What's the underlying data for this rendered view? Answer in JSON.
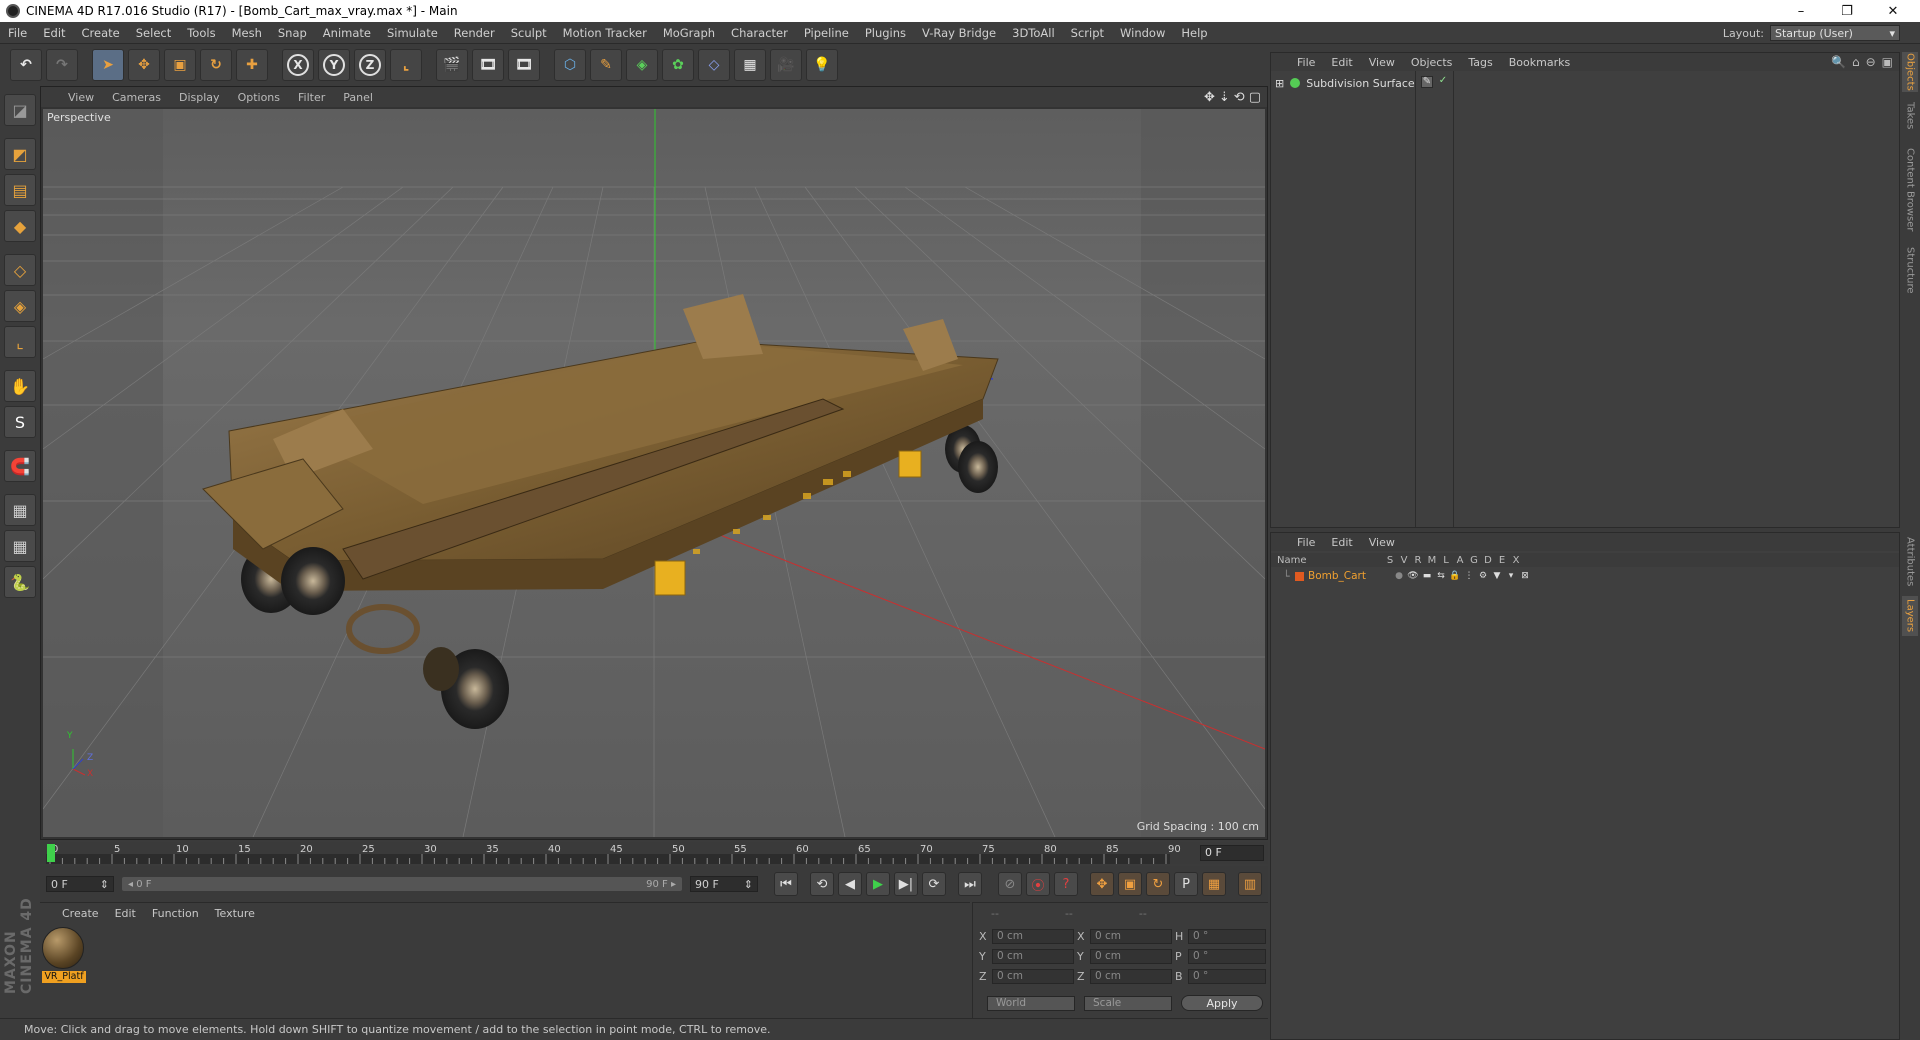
{
  "window": {
    "title": "CINEMA 4D R17.016 Studio (R17) - [Bomb_Cart_max_vray.max *] - Main",
    "controls": [
      "–",
      "❐",
      "✕"
    ]
  },
  "menu": [
    "File",
    "Edit",
    "Create",
    "Select",
    "Tools",
    "Mesh",
    "Snap",
    "Animate",
    "Simulate",
    "Render",
    "Sculpt",
    "Motion Tracker",
    "MoGraph",
    "Character",
    "Pipeline",
    "Plugins",
    "V-Ray Bridge",
    "3DToAll",
    "Script",
    "Window",
    "Help"
  ],
  "layout": {
    "label": "Layout:",
    "value": "Startup (User)"
  },
  "toolbar": {
    "undo": "↶",
    "redo": "↷",
    "select": "➤",
    "move": "✥",
    "scale": "▣",
    "rotate": "↻",
    "live": "✚",
    "x": "X",
    "y": "Y",
    "z": "Z",
    "coord": "⌞",
    "render1": "🎬",
    "render2": "🎞",
    "render3": "🎞",
    "cube": "⬡",
    "pen": "✎",
    "subdiv": "◈",
    "cloner": "✿",
    "deformer": "◇",
    "floor": "▦",
    "camera": "🎥",
    "light": "💡"
  },
  "lefttools": [
    "◪",
    "◩",
    "▤",
    "◆",
    "◇",
    "◈",
    "⌞",
    "✋",
    "S",
    "🧲",
    "▦",
    "▦",
    "🐍"
  ],
  "maxon_logo": "MAXON CINEMA 4D",
  "viewport": {
    "menu": [
      "View",
      "Cameras",
      "Display",
      "Options",
      "Filter",
      "Panel"
    ],
    "nav_icons": [
      "✥",
      "⇣",
      "⟲",
      "▢"
    ],
    "label": "Perspective",
    "grid_spacing": "Grid Spacing : 100 cm",
    "axis_y": "Y",
    "axis_x": "X",
    "axis_z": "Z"
  },
  "timeline": {
    "ticks": [
      0,
      5,
      10,
      15,
      20,
      25,
      30,
      35,
      40,
      45,
      50,
      55,
      60,
      65,
      70,
      75,
      80,
      85,
      90
    ],
    "current_frame": "0 F",
    "start_field": "0 F",
    "range_left": "◂ 0 F",
    "range_right": "90 F ▸",
    "end_field": "90 F"
  },
  "playback": [
    "⏮",
    "⟲",
    "◀",
    "▶",
    "▶|",
    "⟳",
    "⏭"
  ],
  "keytools": [
    "⊘",
    "⦿",
    "?",
    "✥",
    "▣",
    "↻",
    "P",
    "▦",
    "▥"
  ],
  "materials": {
    "menu": [
      "Create",
      "Edit",
      "Function",
      "Texture"
    ],
    "items": [
      {
        "name": "VR_Platf"
      }
    ]
  },
  "coordinates": {
    "header": [
      "--",
      "--",
      "--"
    ],
    "rows": [
      {
        "a": "X",
        "a_val": "0 cm",
        "b": "X",
        "b_val": "0 cm",
        "c": "H",
        "c_val": "0 °"
      },
      {
        "a": "Y",
        "a_val": "0 cm",
        "b": "Y",
        "b_val": "0 cm",
        "c": "P",
        "c_val": "0 °"
      },
      {
        "a": "Z",
        "a_val": "0 cm",
        "b": "Z",
        "b_val": "0 cm",
        "c": "B",
        "c_val": "0 °"
      }
    ],
    "world": "World",
    "scale": "Scale",
    "apply": "Apply"
  },
  "status": "Move: Click and drag to move elements. Hold down SHIFT to quantize movement / add to the selection in point mode, CTRL to remove.",
  "objects": {
    "menu": [
      "File",
      "Edit",
      "View",
      "Objects",
      "Tags",
      "Bookmarks"
    ],
    "icons": [
      "🔍",
      "⌂",
      "⊖",
      "▣"
    ],
    "items": [
      {
        "name": "Subdivision Surface",
        "expand": "⊞"
      }
    ],
    "tags": [
      "✎",
      "✓"
    ]
  },
  "layers": {
    "menu": [
      "File",
      "Edit",
      "View"
    ],
    "columns": [
      "Name",
      "S",
      "V",
      "R",
      "M",
      "L",
      "A",
      "G",
      "D",
      "E",
      "X"
    ],
    "items": [
      {
        "name": "Bomb_Cart",
        "prefix": "└",
        "cells": [
          "●",
          "👁",
          "▬",
          "⇆",
          "🔒",
          "⋮",
          "⚙",
          "▼",
          "▾",
          "⊠"
        ]
      }
    ]
  },
  "sidetabs": {
    "top": [
      "Objects",
      "Takes",
      "Content Browser",
      "Structure"
    ],
    "bottom": [
      "Attributes",
      "Layers"
    ]
  },
  "colors": {
    "accent": "#f0a020",
    "selected_tool": "#5b6e86",
    "play": "#3fd14b",
    "record": "#e04040"
  }
}
